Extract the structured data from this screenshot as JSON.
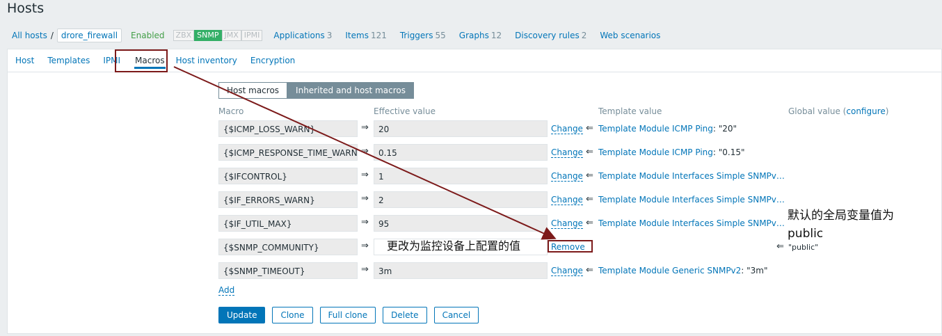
{
  "page_title": "Hosts",
  "breadcrumb": {
    "all_hosts": "All hosts",
    "sep": "/",
    "host": "drore_firewall"
  },
  "status": "Enabled",
  "availability": [
    "ZBX",
    "SNMP",
    "JMX",
    "IPMI"
  ],
  "host_nav": [
    {
      "label": "Applications",
      "count": "3"
    },
    {
      "label": "Items",
      "count": "121"
    },
    {
      "label": "Triggers",
      "count": "55"
    },
    {
      "label": "Graphs",
      "count": "12"
    },
    {
      "label": "Discovery rules",
      "count": "2"
    },
    {
      "label": "Web scenarios",
      "count": ""
    }
  ],
  "tabs": [
    "Host",
    "Templates",
    "IPMI",
    "Macros",
    "Host inventory",
    "Encryption"
  ],
  "active_tab": "Macros",
  "macro_mode": {
    "host": "Host macros",
    "inherited": "Inherited and host macros"
  },
  "headers": {
    "macro": "Macro",
    "effective": "Effective value",
    "template": "Template value",
    "global": "Global value (",
    "configure": "configure",
    "close": ")"
  },
  "arrow_right": "⇒",
  "arrow_left": "⇐",
  "macros": [
    {
      "macro": "{$ICMP_LOSS_WARN}",
      "value": "20",
      "action": "Change",
      "template_link": "Template Module ICMP Ping",
      "template_value": ": \"20\""
    },
    {
      "macro": "{$ICMP_RESPONSE_TIME_WARN}",
      "value": "0.15",
      "action": "Change",
      "template_link": "Template Module ICMP Ping",
      "template_value": ": \"0.15\""
    },
    {
      "macro": "{$IFCONTROL}",
      "value": "1",
      "action": "Change",
      "template_link": "Template Module Interfaces Simple SNMPv…",
      "template_value": ""
    },
    {
      "macro": "{$IF_ERRORS_WARN}",
      "value": "2",
      "action": "Change",
      "template_link": "Template Module Interfaces Simple SNMPv…",
      "template_value": ""
    },
    {
      "macro": "{$IF_UTIL_MAX}",
      "value": "95",
      "action": "Change",
      "template_link": "Template Module Interfaces Simple SNMPv…",
      "template_value": ""
    },
    {
      "macro": "{$SNMP_COMMUNITY}",
      "value": "",
      "action": "Remove",
      "template_link": "",
      "template_value": ""
    },
    {
      "macro": "{$SNMP_TIMEOUT}",
      "value": "3m",
      "action": "Change",
      "template_link": "Template Module Generic SNMPv2",
      "template_value": ": \"3m\""
    }
  ],
  "global_snmp_community": "\"public\"",
  "add_label": "Add",
  "buttons": {
    "update": "Update",
    "clone": "Clone",
    "full_clone": "Full clone",
    "delete": "Delete",
    "cancel": "Cancel"
  },
  "annotations": {
    "value_note": "更改为监控设备上配置的值",
    "global_note_line1": "默认的全局变量值为",
    "global_note_line2": "public"
  },
  "colors": {
    "accent": "#0275b8",
    "enabled": "#429e47",
    "snmp_on": "#34af67",
    "annotation": "#7c1a1a"
  }
}
